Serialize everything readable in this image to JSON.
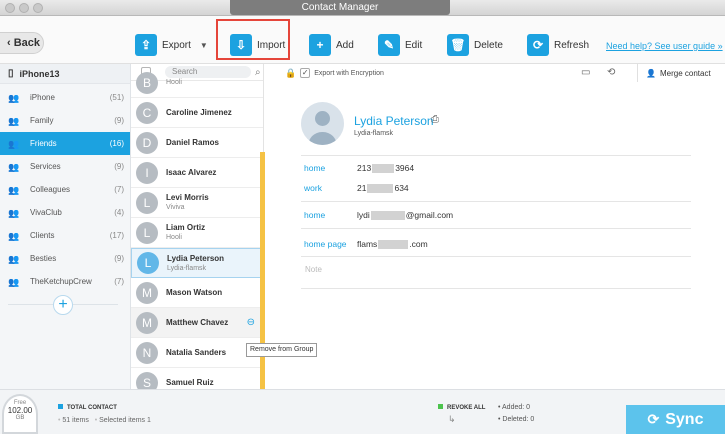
{
  "window": {
    "title": "Contact Manager"
  },
  "toolbar": {
    "back_label": "Back",
    "export_label": "Export",
    "import_label": "Import",
    "add_label": "Add",
    "edit_label": "Edit",
    "delete_label": "Delete",
    "refresh_label": "Refresh",
    "help_link": "Need help? See user guide »"
  },
  "sidebar": {
    "device": "iPhone13",
    "groups": [
      {
        "label": "iPhone",
        "count": "(51)"
      },
      {
        "label": "Family",
        "count": "(9)"
      },
      {
        "label": "Friends",
        "count": "(16)"
      },
      {
        "label": "Services",
        "count": "(9)"
      },
      {
        "label": "Colleagues",
        "count": "(7)"
      },
      {
        "label": "VivaClub",
        "count": "(4)"
      },
      {
        "label": "Clients",
        "count": "(17)"
      },
      {
        "label": "Besties",
        "count": "(9)"
      },
      {
        "label": "TheKetchupCrew",
        "count": "(7)"
      }
    ]
  },
  "list": {
    "search_placeholder": "Search",
    "contacts": [
      {
        "initial": "B",
        "name": "",
        "sub": "Hooli"
      },
      {
        "initial": "C",
        "name": "Caroline Jimenez",
        "sub": ""
      },
      {
        "initial": "D",
        "name": "Daniel Ramos",
        "sub": ""
      },
      {
        "initial": "I",
        "name": "Isaac Alvarez",
        "sub": ""
      },
      {
        "initial": "L",
        "name": "Levi Morris",
        "sub": "Viviva"
      },
      {
        "initial": "L",
        "name": "Liam Ortiz",
        "sub": "Hooli"
      },
      {
        "initial": "L",
        "name": "Lydia Peterson",
        "sub": "Lydia-flamsk"
      },
      {
        "initial": "M",
        "name": "Mason Watson",
        "sub": ""
      },
      {
        "initial": "M",
        "name": "Matthew Chavez",
        "sub": ""
      },
      {
        "initial": "N",
        "name": "Natalia Sanders",
        "sub": ""
      },
      {
        "initial": "S",
        "name": "Samuel Ruiz",
        "sub": ""
      }
    ],
    "tooltip": "Remove from Group"
  },
  "detail": {
    "encryption_label": "Export with Encryption",
    "merge_label": "Merge contact",
    "name": "Lydia Peterson",
    "nickname": "Lydia-flamsk",
    "phone_home_label": "home",
    "phone_home_a": "213",
    "phone_home_b": "3964",
    "phone_work_label": "work",
    "phone_work_a": "21",
    "phone_work_b": "634",
    "email_label": "home",
    "email_a": "lydi",
    "email_b": "@gmail.com",
    "url_label": "home page",
    "url_a": "flams",
    "url_b": ".com",
    "note_label": "Note"
  },
  "footer": {
    "disk_label": "Free",
    "disk_value": "102.00",
    "disk_unit": "GB",
    "total_label": "TOTAL CONTACT",
    "items": "51 items",
    "selected": "Selected items 1",
    "revoke_label": "REVOKE ALL",
    "added": "Added: 0",
    "deleted": "Deleted: 0",
    "sync_label": "Sync"
  },
  "colors": {
    "accent": "#1ca2e0",
    "highlight": "#e5453a",
    "scroll": "#f5c244"
  }
}
